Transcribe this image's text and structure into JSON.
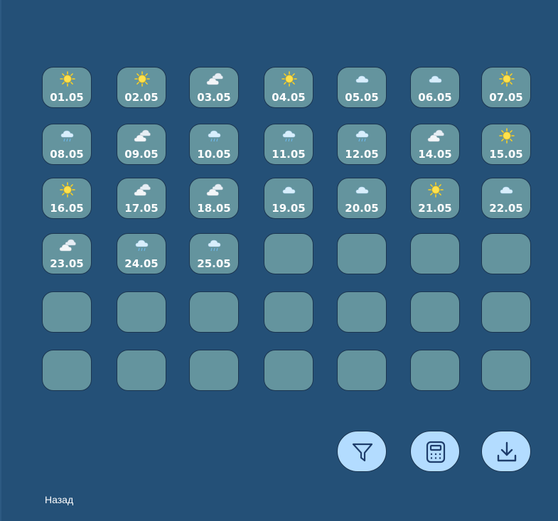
{
  "calendar": {
    "days": [
      {
        "date": "01.05",
        "icon": "sun-icon"
      },
      {
        "date": "02.05",
        "icon": "sun-icon"
      },
      {
        "date": "03.05",
        "icon": "cloudy-icon"
      },
      {
        "date": "04.05",
        "icon": "sun-icon"
      },
      {
        "date": "05.05",
        "icon": "cloud-icon"
      },
      {
        "date": "06.05",
        "icon": "cloud-icon"
      },
      {
        "date": "07.05",
        "icon": "sun-icon"
      },
      {
        "date": "08.05",
        "icon": "rain-icon"
      },
      {
        "date": "09.05",
        "icon": "cloudy-icon"
      },
      {
        "date": "10.05",
        "icon": "rain-icon"
      },
      {
        "date": "11.05",
        "icon": "rain-icon"
      },
      {
        "date": "12.05",
        "icon": "rain-icon"
      },
      {
        "date": "14.05",
        "icon": "cloudy-icon"
      },
      {
        "date": "15.05",
        "icon": "sun-icon"
      },
      {
        "date": "16.05",
        "icon": "sun-icon"
      },
      {
        "date": "17.05",
        "icon": "cloudy-icon"
      },
      {
        "date": "18.05",
        "icon": "cloudy-icon"
      },
      {
        "date": "19.05",
        "icon": "cloud-icon"
      },
      {
        "date": "20.05",
        "icon": "cloud-icon"
      },
      {
        "date": "21.05",
        "icon": "sun-icon"
      },
      {
        "date": "22.05",
        "icon": "cloud-icon"
      },
      {
        "date": "23.05",
        "icon": "cloudy-icon"
      },
      {
        "date": "24.05",
        "icon": "rain-icon"
      },
      {
        "date": "25.05",
        "icon": "rain-icon"
      },
      {
        "date": "",
        "icon": ""
      },
      {
        "date": "",
        "icon": ""
      },
      {
        "date": "",
        "icon": ""
      },
      {
        "date": "",
        "icon": ""
      },
      {
        "date": "",
        "icon": ""
      },
      {
        "date": "",
        "icon": ""
      },
      {
        "date": "",
        "icon": ""
      },
      {
        "date": "",
        "icon": ""
      },
      {
        "date": "",
        "icon": ""
      },
      {
        "date": "",
        "icon": ""
      },
      {
        "date": "",
        "icon": ""
      },
      {
        "date": "",
        "icon": ""
      },
      {
        "date": "",
        "icon": ""
      },
      {
        "date": "",
        "icon": ""
      },
      {
        "date": "",
        "icon": ""
      },
      {
        "date": "",
        "icon": ""
      },
      {
        "date": "",
        "icon": ""
      },
      {
        "date": "",
        "icon": ""
      }
    ]
  },
  "actions": [
    {
      "name": "filter-button",
      "icon": "filter-icon"
    },
    {
      "name": "calculator-button",
      "icon": "calculator-icon"
    },
    {
      "name": "download-button",
      "icon": "download-icon"
    }
  ],
  "footer": {
    "back_label": "Назад"
  },
  "colors": {
    "background": "#245077",
    "cell": "#64949e",
    "action_button": "#b3dcff",
    "icon_stroke": "#1e3d6b",
    "sun": "#ffe14d"
  }
}
